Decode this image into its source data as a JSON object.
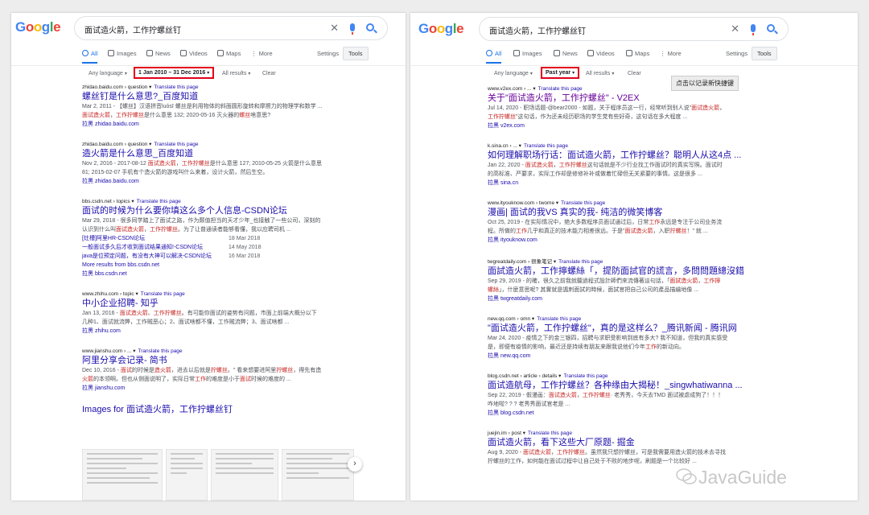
{
  "logo_text": "Google",
  "search_query": "面试造火箭，工作拧螺丝钉",
  "tabs": [
    "All",
    "Images",
    "News",
    "Videos",
    "Maps",
    "More"
  ],
  "settings_label": "Settings",
  "tools_label": "Tools",
  "colors": {
    "google_blue": "#4285F4",
    "google_red": "#EA4335",
    "google_yellow": "#FBBC05",
    "google_green": "#34A853",
    "link": "#1A0DAB",
    "highlight_box": "#E2001A"
  },
  "left": {
    "tools": {
      "language": "Any language",
      "time": "1 Jan 2010 – 31 Dec 2016",
      "results": "All results",
      "clear": "Clear"
    },
    "results": [
      {
        "cite": "zhidao.baidu.com › question",
        "translate": "Translate this page",
        "title": "螺丝钉是什么意思?_百度知道",
        "lines": [
          [
            {
              "t": "Mar 2, 2011 - 【螺丝】汉语拼音luósī 螺丝是利用物体的斜面圆形旋转和摩擦力的物理学和数学 ..."
            }
          ],
          [
            {
              "t": "面试造火箭",
              "em": true
            },
            {
              "t": "，"
            },
            {
              "t": "工作拧螺丝",
              "em": true
            },
            {
              "t": "是什么意思 132; 2020-05-16 灭火器的"
            },
            {
              "t": "螺丝",
              "em": true
            },
            {
              "t": "啥意思?"
            }
          ]
        ],
        "link": "拉黑 zhidao.baidu.com"
      },
      {
        "cite": "zhidao.baidu.com › question",
        "translate": "Translate this page",
        "title": "造火箭是什么意思_百度知道",
        "lines": [
          [
            {
              "t": "Nov 2, 2016 - 2017-08-12 "
            },
            {
              "t": "面试造火箭",
              "em": true
            },
            {
              "t": "，"
            },
            {
              "t": "工作拧螺丝",
              "em": true
            },
            {
              "t": "是什么意思 127; 2010-05-25 火箭是什么意思"
            }
          ],
          [
            {
              "t": "81; 2015-02-07 手机有个造火箭的游戏叫什么来着，设计火箭，然后生空。"
            }
          ]
        ],
        "link": "拉黑 zhidao.baidu.com"
      },
      {
        "cite": "bbs.csdn.net › topics",
        "translate": "Translate this page",
        "title": "面试的时候为什么要你填这么多个人信息-CSDN论坛",
        "lines": [
          [
            {
              "t": "Mar 29, 2018 - 很多同学踏上了面试之路，作为颇值担当的天才少年_也接触了一些公司，深刻的"
            }
          ],
          [
            {
              "t": "认识到什么叫"
            },
            {
              "t": "面试造火箭",
              "em": true
            },
            {
              "t": "，"
            },
            {
              "t": "工作拧螺丝",
              "em": true
            },
            {
              "t": "。为了让普通读者能够看懂，我以应聘司机 ..."
            }
          ]
        ],
        "sublinks": [
          {
            "title": "[灶槽]阿里HR-CSDN论坛",
            "date": "18 Mar 2018"
          },
          {
            "title": "一般面试多久后才收到面试结果通知!-CSDN论坛",
            "date": "14 May 2018"
          },
          {
            "title": "java是位预定问题，有没有大神可以解决-CSDN论坛",
            "date": "16 Mar 2018"
          }
        ],
        "more": "More results from bbs.csdn.net",
        "link": "拉黑 bbs.csdn.net"
      },
      {
        "cite": "www.zhihu.com › topic",
        "translate": "Translate this page",
        "title": "中小企业招聘- 知乎",
        "lines": [
          [
            {
              "t": "Jan 13, 2016 - "
            },
            {
              "t": "面试造火箭",
              "em": true
            },
            {
              "t": "、"
            },
            {
              "t": "工作拧螺丝",
              "em": true
            },
            {
              "t": "。有可能你面试的姿势有问题，市面上前端大概分以下"
            }
          ],
          [
            {
              "t": "几种1、面试就流弊，工作贼恶心；2、面试啥都不懂，工作贼流弊；3、面试啥都 ..."
            }
          ]
        ],
        "link": "拉黑 zhihu.com"
      },
      {
        "cite": "www.jianshu.com › ...",
        "translate": "Translate this page",
        "title": "阿里分享会记录- 简书",
        "lines": [
          [
            {
              "t": "Dec 10, 2016 - "
            },
            {
              "t": "面试",
              "em": true
            },
            {
              "t": "的时候是"
            },
            {
              "t": "造火箭",
              "em": true
            },
            {
              "t": "，进去以后就是"
            },
            {
              "t": "拧螺丝",
              "em": true
            },
            {
              "t": "。\" 看来想要进阿里"
            },
            {
              "t": "拧螺丝",
              "em": true
            },
            {
              "t": "，得先有造"
            }
          ],
          [
            {
              "t": "火箭",
              "em": true
            },
            {
              "t": "的本领啊。但也从侧面说明了，实际日常"
            },
            {
              "t": "工作",
              "em": true
            },
            {
              "t": "的难度是小于"
            },
            {
              "t": "面试",
              "em": true
            },
            {
              "t": "时候的难度的 ..."
            }
          ]
        ],
        "link": "拉黑 jianshu.com"
      }
    ],
    "images_title": "Images for 面试造火箭，工作拧螺丝钉"
  },
  "right": {
    "tools": {
      "language": "Any language",
      "time": "Past year",
      "results": "All results",
      "clear": "Clear"
    },
    "tooltip": "点击以记录新快捷键",
    "results": [
      {
        "cite": "www.v2ex.com › ...",
        "translate": "Translate this page",
        "title": "关于\"面试造火箭，工作拧螺丝\" - V2EX",
        "visited": true,
        "lines": [
          [
            {
              "t": "Jul 14, 2020 - 职场话题-@bear2000 - 如题，关于程序员这一行，经常听到别人说\""
            },
            {
              "t": "面试造火箭",
              "em": true
            },
            {
              "t": "，"
            }
          ],
          [
            {
              "t": "工作拧螺丝",
              "em": true
            },
            {
              "t": "\"这句话，作为还未经历职场的学生党有些好奇，这句话在多大程度 ..."
            }
          ]
        ],
        "link": "拉黑 v2ex.com"
      },
      {
        "cite": "k.sina.cn › ...",
        "translate": "Translate this page",
        "title": "如何理解职场行话：面试造火箭，工作拧螺丝？聪明人从这4点 ...",
        "lines": [
          [
            {
              "t": "Jan 22, 2020 - "
            },
            {
              "t": "面试造火箭",
              "em": true
            },
            {
              "t": "，"
            },
            {
              "t": "工作拧螺丝",
              "em": true
            },
            {
              "t": "这句话就是不少行业找工作面试时的真实写照。面试时"
            }
          ],
          [
            {
              "t": "的高标准、严要求，实际工作却是修修补补或做着忙碌但无关紧要的事情。这是很多 ..."
            }
          ]
        ],
        "link": "拉黑 sina.cn"
      },
      {
        "cite": "www.ityouknow.com › twome",
        "translate": "Translate this page",
        "title": "漫画| 面试的我VS 真实的我- 纯洁的微笑博客",
        "lines": [
          [
            {
              "t": "Oct 25, 2019 - 在实际情况中，绝大多数程序员面试通过后，日常"
            },
            {
              "t": "工作",
              "em": true
            },
            {
              "t": "永远是专注于公司业务流"
            }
          ],
          [
            {
              "t": "程。所做的"
            },
            {
              "t": "工作",
              "em": true
            },
            {
              "t": "几乎和真正的技术能力相差很远。于是\""
            },
            {
              "t": "面试造火箭",
              "em": true
            },
            {
              "t": "，入职"
            },
            {
              "t": "拧螺丝",
              "em": true
            },
            {
              "t": "！\" 就 ..."
            }
          ]
        ],
        "link": "拉黑 ityouknow.com"
      },
      {
        "cite": "twgreatdaily.com › 很象笔记",
        "translate": "Translate this page",
        "title": "面試造火箭，工作擰螺絲「，提防面試官的謊言，多問問題總沒錯",
        "lines": [
          [
            {
              "t": "Sep 29, 2019 - 的確，很久之前我就聽過程式設計師們來流傳著這句話，「"
            },
            {
              "t": "面試造火箭",
              "em": true
            },
            {
              "t": "，"
            },
            {
              "t": "工作擰",
              "em": true
            }
          ],
          [
            {
              "t": "螺絲",
              "em": true
            },
            {
              "t": "」，什麼意思呢? 其實就是諷刺面試的時候，面試官把自己公司的產品描繪地像 ..."
            }
          ]
        ],
        "link": "拉黑 twgreatdaily.com"
      },
      {
        "cite": "new.qq.com › omn",
        "translate": "Translate this page",
        "title": "\"面试造火箭，工作拧螺丝\"，真的是这样么？_腾讯新闻 - 腾讯网",
        "lines": [
          [
            {
              "t": "Mar 24, 2020 - 疫情之下的金三银四，招聘与求职受影响到底有多大? 我不知道，但我的真实感受"
            }
          ],
          [
            {
              "t": "是，即便有疫情的影响，最近还是持续有朋友来跟我说他们今年"
            },
            {
              "t": "工作",
              "em": true
            },
            {
              "t": "的新动向。"
            }
          ]
        ],
        "link": "拉黑 new.qq.com"
      },
      {
        "cite": "blog.csdn.net › article › details",
        "translate": "Translate this page",
        "title": "面试造航母，工作拧螺丝？各种缘由大揭秘！_singwhatiwanna ...",
        "lines": [
          [
            {
              "t": "Sep 22, 2019 - 假漫画："
            },
            {
              "t": "面试造火箭",
              "em": true
            },
            {
              "t": "，"
            },
            {
              "t": "工作拧螺丝",
              "em": true
            },
            {
              "t": "· 老秀秀，今天去TMD 面试被虐成狗了！！！"
            }
          ],
          [
            {
              "t": "咋地啦? ? ? 老秀秀面试官老是 ..."
            }
          ]
        ],
        "link": "拉黑 blog.csdn.net"
      },
      {
        "cite": "juejin.im › post",
        "translate": "Translate this page",
        "title": "面试造火箭，看下这些大厂原题- 掘金",
        "lines": [
          [
            {
              "t": "Aug 9, 2020 - "
            },
            {
              "t": "面试造火箭",
              "em": true
            },
            {
              "t": "，"
            },
            {
              "t": "工作拧螺丝",
              "em": true
            },
            {
              "t": "。虽然我只想拧螺丝，可是我需要用造火箭的技术去寻找"
            }
          ],
          [
            {
              "t": "拧螺丝的工作，如何能在面试过程中让自己处于不败的地步呢，刷题是一个比较好 ..."
            }
          ]
        ],
        "link": ""
      }
    ]
  },
  "watermark_text": "JavaGuide"
}
